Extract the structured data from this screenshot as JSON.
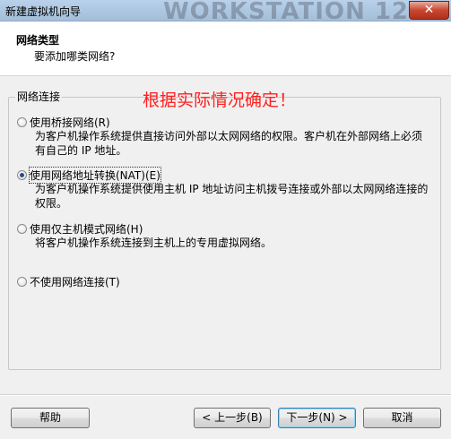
{
  "window": {
    "title": "新建虚拟机向导",
    "watermark": "WORKSTATION 12",
    "close_glyph": "✕"
  },
  "header": {
    "title": "网络类型",
    "subtitle": "要添加哪类网络?"
  },
  "group": {
    "legend": "网络连接",
    "annotation": "根据实际情况确定！"
  },
  "options": [
    {
      "label": "使用桥接网络(R)",
      "desc_line1": "为客户机操作系统提供直接访问外部以太网网络的权限。客户机在外部网络上必须",
      "desc_line2": "有自己的 IP 地址。",
      "selected": false
    },
    {
      "label": "使用网络地址转换(NAT)(E)",
      "desc_line1": "为客户机操作系统提供使用主机 IP 地址访问主机拨号连接或外部以太网网络连接的",
      "desc_line2": "权限。",
      "selected": true
    },
    {
      "label": "使用仅主机模式网络(H)",
      "desc_line1": "将客户机操作系统连接到主机上的专用虚拟网络。",
      "selected": false
    },
    {
      "label": "不使用网络连接(T)",
      "selected": false
    }
  ],
  "buttons": {
    "help": "帮助",
    "back": "< 上一步(B)",
    "next": "下一步(N) >",
    "cancel": "取消"
  },
  "colors": {
    "annotation": "#ff2020",
    "titlebar": "#b9d1ea"
  }
}
